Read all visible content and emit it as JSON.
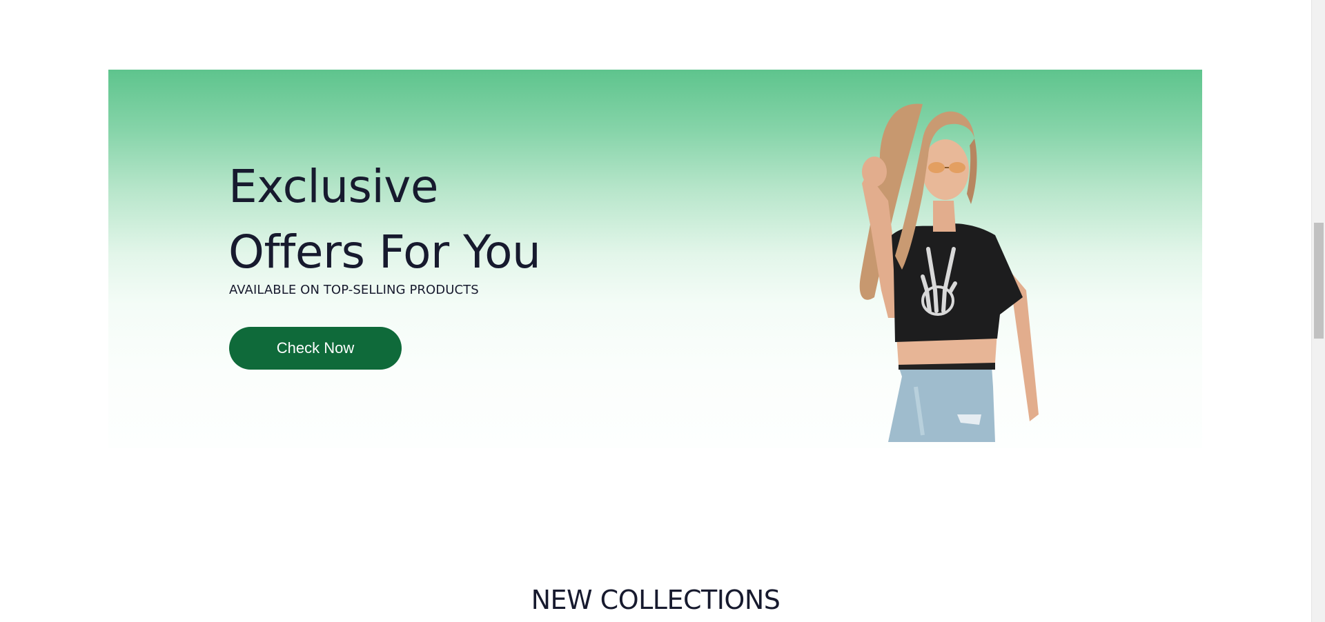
{
  "hero": {
    "title_line1": "Exclusive",
    "title_line2": "Offers For You",
    "subtitle": "AVAILABLE ON TOP-SELLING PRODUCTS",
    "cta_label": "Check Now",
    "image": "model-photo",
    "colors": {
      "gradient_top": "#5ec48d",
      "gradient_bottom": "#fdfffe",
      "button": "#0f6a3a",
      "heading": "#171a2e"
    }
  },
  "collections": {
    "title": "NEW COLLECTIONS"
  }
}
